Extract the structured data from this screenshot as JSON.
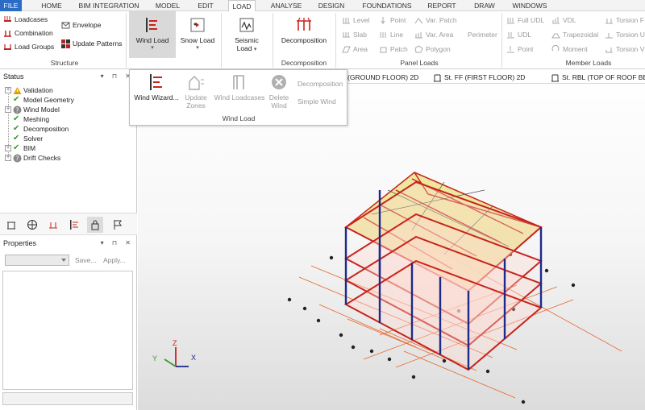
{
  "menu": {
    "file": "FILE",
    "items": [
      "HOME",
      "BIM INTEGRATION",
      "MODEL",
      "EDIT",
      "LOAD",
      "ANALYSE",
      "DESIGN",
      "FOUNDATIONS",
      "REPORT",
      "DRAW",
      "WINDOWS"
    ]
  },
  "ribbon": {
    "structure": {
      "loadcases": "Loadcases",
      "combination": "Combination",
      "load_groups": "Load Groups",
      "envelope": "Envelope",
      "update_patterns": "Update Patterns",
      "label": "Structure"
    },
    "wind_load": "Wind Load",
    "snow_load": "Snow Load",
    "seismic_load_1": "Seismic",
    "seismic_load_2": "Load",
    "decomposition": {
      "button": "Decomposition",
      "label": "Decomposition"
    },
    "panel_loads": {
      "level": "Level",
      "slab": "Slab",
      "area": "Area",
      "point": "Point",
      "line": "Line",
      "patch": "Patch",
      "var_patch": "Var. Patch",
      "var_area": "Var. Area",
      "polygon": "Polygon",
      "perimeter": "Perimeter",
      "label": "Panel Loads"
    },
    "member_loads": {
      "full_udl": "Full UDL",
      "udl": "UDL",
      "point": "Point",
      "vdl": "VDL",
      "trapezoidal": "Trapezoidal",
      "moment": "Moment",
      "torsion_f": "Torsion F",
      "torsion_u": "Torsion U",
      "torsion_v": "Torsion V",
      "label": "Member Loads"
    }
  },
  "wind_dropdown": {
    "wizard": "Wind Wizard...",
    "update_zones_1": "Update",
    "update_zones_2": "Zones",
    "wind_loadcases": "Wind Loadcases",
    "delete_wind_1": "Delete",
    "delete_wind_2": "Wind",
    "decomposition": "Decomposition",
    "simple_wind": "Simple Wind",
    "label": "Wind Load"
  },
  "view_tabs": [
    "(GROUND FLOOR) 2D",
    "St. FF (FIRST FLOOR) 2D",
    "St. RBL (TOP OF ROOF BEAM L"
  ],
  "status_panel": {
    "title": "Status",
    "items": [
      "Validation",
      "Model Geometry",
      "Wind Model",
      "Meshing",
      "Decomposition",
      "Solver",
      "BIM",
      "Drift Checks"
    ]
  },
  "properties_panel": {
    "title": "Properties",
    "save": "Save...",
    "apply": "Apply..."
  },
  "axes": {
    "x": "X",
    "y": "Y",
    "z": "Z"
  },
  "colors": {
    "file_tab": "#2b6cc4",
    "member_red": "#c8231b",
    "column_blue": "#1d2a8a",
    "roof": "#e9e38a",
    "grid_orange": "#e8652a",
    "check_green": "#3a9a2e",
    "warning": "#e0a000"
  }
}
